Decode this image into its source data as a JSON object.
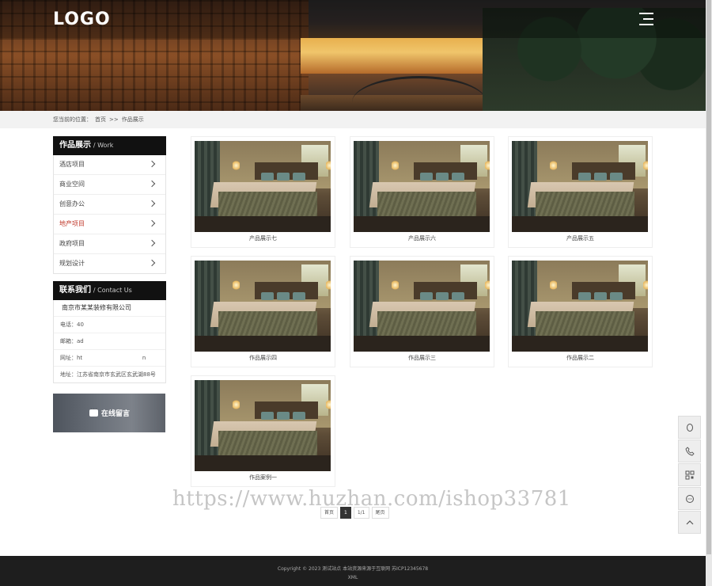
{
  "header": {
    "logo": "LOGO"
  },
  "breadcrumb": {
    "prefix": "您当前的位置：",
    "home": "首页",
    "sep": ">>",
    "current": "作品展示"
  },
  "sidebar": {
    "title": "作品展示",
    "subtitle": "/ Work",
    "items": [
      {
        "label": "酒店项目",
        "active": false
      },
      {
        "label": "商业空间",
        "active": false
      },
      {
        "label": "创意办公",
        "active": false
      },
      {
        "label": "地产项目",
        "active": true
      },
      {
        "label": "政府项目",
        "active": false
      },
      {
        "label": "规划设计",
        "active": false
      }
    ]
  },
  "contact": {
    "title": "联系我们",
    "subtitle": "/ Contact Us",
    "company": "南京市某某装修有限公司",
    "phone": "电话：40",
    "email": "邮箱：ad",
    "website": "网址：ht                                  n",
    "address": "地址：江苏省南京市玄武区玄武湖88号"
  },
  "message_button": {
    "label": "在线留言"
  },
  "products": [
    {
      "label": "产品展示七"
    },
    {
      "label": "产品展示六"
    },
    {
      "label": "产品展示五"
    },
    {
      "label": "作品展示四"
    },
    {
      "label": "作品展示三"
    },
    {
      "label": "作品展示二"
    },
    {
      "label": "作品案例一"
    }
  ],
  "pagination": {
    "first": "首页",
    "current": "1",
    "info": "1/1",
    "last": "尾页"
  },
  "watermark": "https://www.huzhan.com/ishop33781",
  "float_bar": {
    "icons": [
      "qq-icon",
      "phone-icon",
      "qrcode-icon",
      "chat-icon",
      "back-to-top-icon"
    ]
  },
  "footer": {
    "line1": "Copyright © 2023 测试站点 本站资源来源于互联网 苏ICP12345678",
    "line2": "XML"
  }
}
